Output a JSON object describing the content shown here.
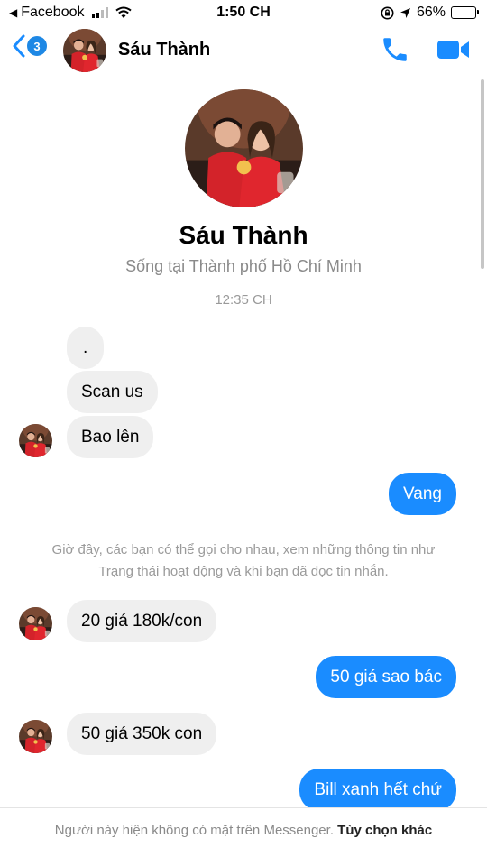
{
  "status_bar": {
    "back_app": "Facebook",
    "time": "1:50 CH",
    "battery": "66%",
    "battery_level": 0.66
  },
  "header": {
    "back_badge": "3",
    "contact_name": "Sáu Thành",
    "icons": [
      "back-chevron-icon",
      "phone-icon",
      "video-camera-icon"
    ]
  },
  "profile": {
    "name": "Sáu Thành",
    "location": "Sống tại Thành phố Hồ Chí Minh"
  },
  "chat": {
    "timestamp": "12:35 CH",
    "messages": [
      {
        "side": "in",
        "text": "."
      },
      {
        "side": "in",
        "text": "Scan us"
      },
      {
        "side": "in",
        "text": "Bao lên"
      },
      {
        "side": "out",
        "text": "Vang"
      },
      {
        "side": "in",
        "text": "20 giá 180k/con"
      },
      {
        "side": "out",
        "text": "50 giá sao bác"
      },
      {
        "side": "in",
        "text": "50 giá 350k con"
      },
      {
        "side": "out",
        "text": "Bill xanh hết chứ"
      }
    ],
    "system_note_line1": "Giờ đây, các bạn có thể gọi cho nhau, xem những thông tin như",
    "system_note_line2": "Trạng thái hoạt động và khi bạn đã đọc tin nhắn."
  },
  "footer": {
    "offline_text": "Người này hiện không có mặt trên Messenger.",
    "options_link": "Tùy chọn khác"
  },
  "colors": {
    "accent": "#1a8cff",
    "incoming_bubble": "#efefef",
    "muted_text": "#8a8a8a"
  }
}
